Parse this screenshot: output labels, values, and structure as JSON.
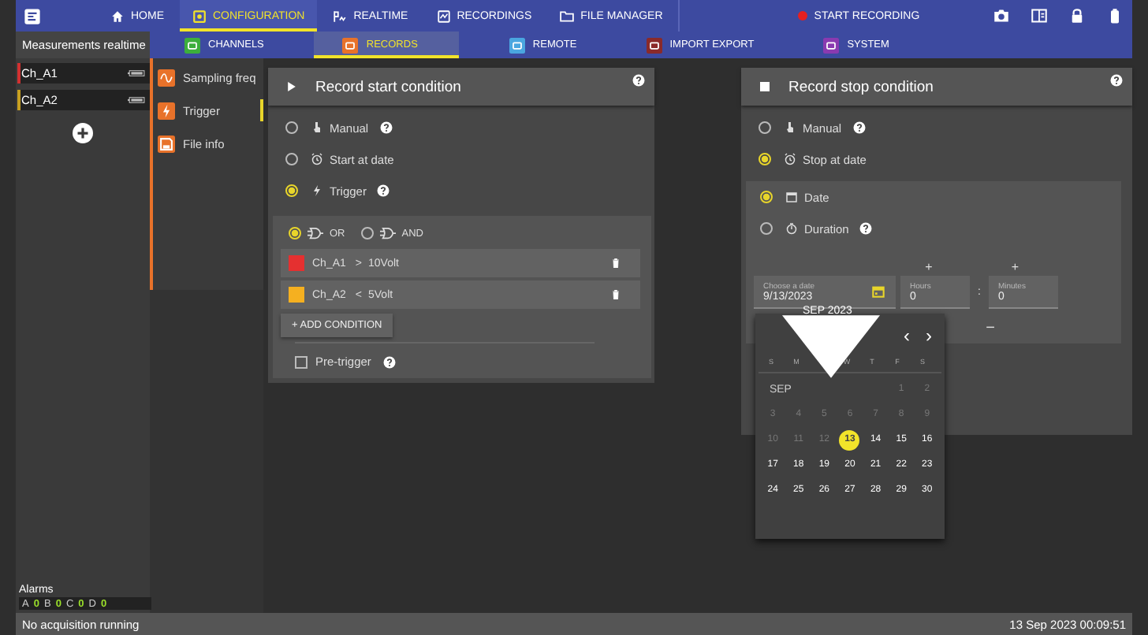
{
  "top_nav": {
    "items": [
      {
        "label": "HOME",
        "kind": "home",
        "selected": false
      },
      {
        "label": "CONFIGURATION",
        "kind": "config",
        "selected": true
      },
      {
        "label": "REALTIME",
        "kind": "realtime",
        "selected": false
      },
      {
        "label": "RECORDINGS",
        "kind": "recordings",
        "selected": false
      },
      {
        "label": "FILE MANAGER",
        "kind": "folder",
        "selected": false
      }
    ],
    "record_button": "START RECORDING"
  },
  "sub_nav": {
    "title": "Measurements realtime",
    "items": [
      {
        "label": "CHANNELS",
        "color": "#3cae3c",
        "selected": false
      },
      {
        "label": "RECORDS",
        "color": "#e8722a",
        "selected": true
      },
      {
        "label": "REMOTE",
        "color": "#4aa6e0",
        "selected": false
      },
      {
        "label": "IMPORT EXPORT",
        "color": "#8a2a2a",
        "selected": false
      },
      {
        "label": "SYSTEM",
        "color": "#8a3ab0",
        "selected": false
      }
    ]
  },
  "channels": [
    {
      "name": "Ch_A1",
      "color": "#d23030"
    },
    {
      "name": "Ch_A2",
      "color": "#c8a020"
    }
  ],
  "alarms": {
    "title": "Alarms",
    "items": [
      {
        "label": "A",
        "value": "0"
      },
      {
        "label": "B",
        "value": "0"
      },
      {
        "label": "C",
        "value": "0"
      },
      {
        "label": "D",
        "value": "0"
      }
    ]
  },
  "side_menu": [
    {
      "label": "Sampling freq",
      "kind": "wave",
      "selected": false
    },
    {
      "label": "Trigger",
      "kind": "boltbox",
      "selected": true
    },
    {
      "label": "File info",
      "kind": "save",
      "selected": false
    }
  ],
  "start_card": {
    "title": "Record start condition",
    "options": [
      {
        "label": "Manual",
        "kind": "hand",
        "selected": false,
        "help": true
      },
      {
        "label": "Start at date",
        "kind": "clock",
        "selected": false,
        "help": false
      },
      {
        "label": "Trigger",
        "kind": "bolt",
        "selected": true,
        "help": true
      }
    ],
    "logic": [
      {
        "label": "OR",
        "selected": true
      },
      {
        "label": "AND",
        "selected": false
      }
    ],
    "conditions": [
      {
        "channel": "Ch_A1",
        "operator": ">",
        "value": "10Volt",
        "color": "#e53030"
      },
      {
        "channel": "Ch_A2",
        "operator": "<",
        "value": "5Volt",
        "color": "#f5b020"
      }
    ],
    "add_button": "+ ADD CONDITION",
    "pretrigger": {
      "label": "Pre-trigger",
      "checked": false
    }
  },
  "stop_card": {
    "title": "Record stop condition",
    "options": [
      {
        "label": "Manual",
        "kind": "hand",
        "selected": false,
        "help": true
      },
      {
        "label": "Stop at date",
        "kind": "clock",
        "selected": true,
        "help": false
      }
    ],
    "sub_options": [
      {
        "label": "Date",
        "kind": "calendar",
        "selected": true,
        "help": false
      },
      {
        "label": "Duration",
        "kind": "timer",
        "selected": false,
        "help": true
      }
    ],
    "increment": [
      "+",
      "+"
    ],
    "decrement": "−",
    "date_field": {
      "label": "Choose a date",
      "value": "9/13/2023"
    },
    "hours_field": {
      "label": "Hours",
      "value": "0"
    },
    "separator": ":",
    "minutes_field": {
      "label": "Minutes",
      "value": "0"
    },
    "calendar": {
      "header": "SEP 2023",
      "prev": "‹",
      "next": "›",
      "weekdays": [
        "S",
        "M",
        "W",
        "T",
        "F",
        "S"
      ],
      "month": "SEP",
      "days": [
        {
          "label": "1",
          "disabled": true,
          "selected": false
        },
        {
          "label": "2",
          "disabled": true,
          "selected": false
        },
        {
          "label": "3",
          "disabled": true,
          "selected": false
        },
        {
          "label": "4",
          "disabled": true,
          "selected": false
        },
        {
          "label": "5",
          "disabled": true,
          "selected": false
        },
        {
          "label": "6",
          "disabled": true,
          "selected": false
        },
        {
          "label": "7",
          "disabled": true,
          "selected": false
        },
        {
          "label": "8",
          "disabled": true,
          "selected": false
        },
        {
          "label": "9",
          "disabled": true,
          "selected": false
        },
        {
          "label": "10",
          "disabled": true,
          "selected": false
        },
        {
          "label": "11",
          "disabled": true,
          "selected": false
        },
        {
          "label": "12",
          "disabled": true,
          "selected": false
        },
        {
          "label": "13",
          "disabled": false,
          "selected": true
        },
        {
          "label": "14",
          "disabled": false,
          "selected": false
        },
        {
          "label": "15",
          "disabled": false,
          "selected": false
        },
        {
          "label": "16",
          "disabled": false,
          "selected": false
        },
        {
          "label": "17",
          "disabled": false,
          "selected": false
        },
        {
          "label": "18",
          "disabled": false,
          "selected": false
        },
        {
          "label": "19",
          "disabled": false,
          "selected": false
        },
        {
          "label": "20",
          "disabled": false,
          "selected": false
        },
        {
          "label": "21",
          "disabled": false,
          "selected": false
        },
        {
          "label": "22",
          "disabled": false,
          "selected": false
        },
        {
          "label": "23",
          "disabled": false,
          "selected": false
        },
        {
          "label": "24",
          "disabled": false,
          "selected": false
        },
        {
          "label": "25",
          "disabled": false,
          "selected": false
        },
        {
          "label": "26",
          "disabled": false,
          "selected": false
        },
        {
          "label": "27",
          "disabled": false,
          "selected": false
        },
        {
          "label": "28",
          "disabled": false,
          "selected": false
        },
        {
          "label": "29",
          "disabled": false,
          "selected": false
        },
        {
          "label": "30",
          "disabled": false,
          "selected": false
        }
      ]
    }
  },
  "status_bar": {
    "left": "No acquisition running",
    "right": "13 Sep 2023 00:09:51"
  }
}
